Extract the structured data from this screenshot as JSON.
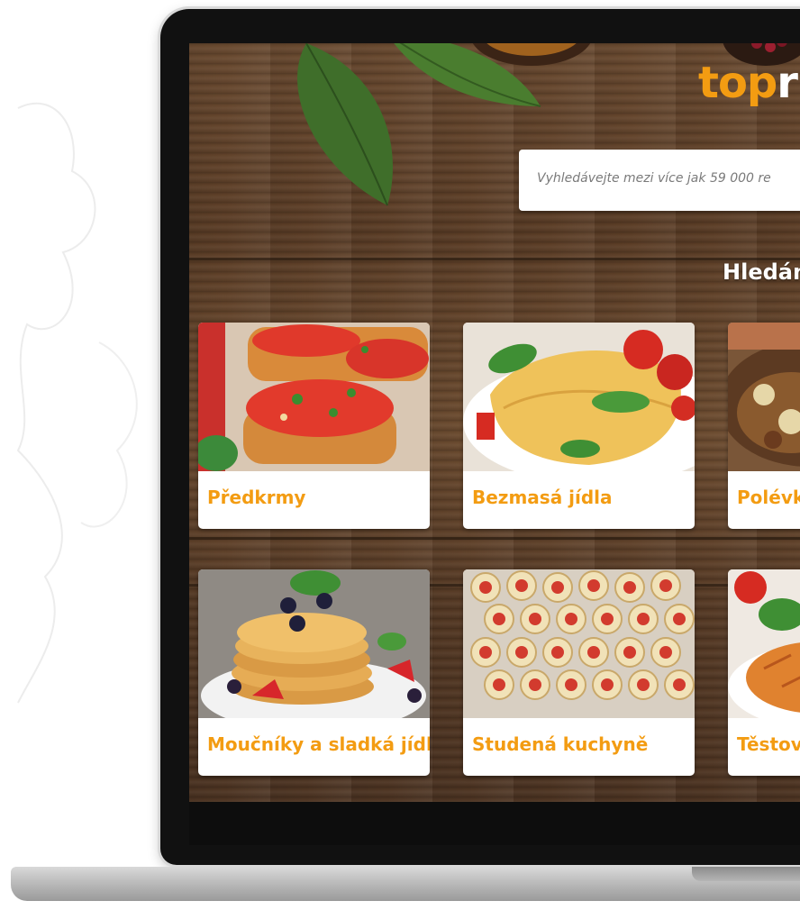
{
  "site": {
    "logo_part1": "top",
    "logo_part2": "r"
  },
  "search": {
    "placeholder": "Vyhledávejte mezi více jak 59 000 re"
  },
  "heading": "Hledán",
  "categories": [
    {
      "label": "Předkrmy"
    },
    {
      "label": "Bezmasá jídla"
    },
    {
      "label": "Polévky"
    },
    {
      "label": "Moučníky a sladká jídla"
    },
    {
      "label": "Studená kuchyně"
    },
    {
      "label": "Těstovi"
    }
  ],
  "colors": {
    "accent": "#f39c12",
    "wood": "#5b3d26"
  }
}
